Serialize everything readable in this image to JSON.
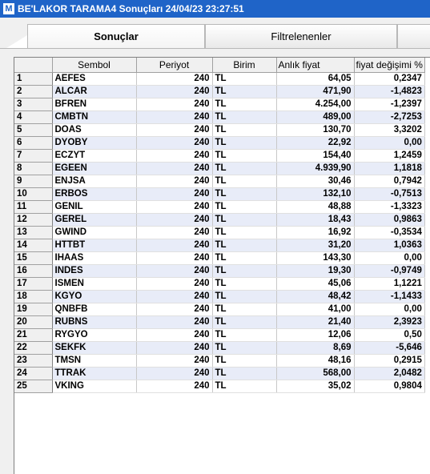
{
  "window": {
    "logo_letter": "M",
    "title": "BE'LAKOR TARAMA4 Sonuçları  24/04/23 23:27:51"
  },
  "tabs": [
    {
      "label": "Sonuçlar",
      "active": true
    },
    {
      "label": "Filtrelenenler",
      "active": false
    },
    {
      "label": "",
      "active": false
    }
  ],
  "table": {
    "headers": {
      "num": "",
      "sembol": "Sembol",
      "periyot": "Periyot",
      "birim": "Birim",
      "anlik": "Anlık fiyat",
      "degisim": "fiyat değişimi %"
    },
    "rows": [
      [
        "1",
        "AEFES",
        "240",
        "TL",
        "64,05",
        "0,2347"
      ],
      [
        "2",
        "ALCAR",
        "240",
        "TL",
        "471,90",
        "-1,4823"
      ],
      [
        "3",
        "BFREN",
        "240",
        "TL",
        "4.254,00",
        "-1,2397"
      ],
      [
        "4",
        "CMBTN",
        "240",
        "TL",
        "489,00",
        "-2,7253"
      ],
      [
        "5",
        "DOAS",
        "240",
        "TL",
        "130,70",
        "3,3202"
      ],
      [
        "6",
        "DYOBY",
        "240",
        "TL",
        "22,92",
        "0,00"
      ],
      [
        "7",
        "ECZYT",
        "240",
        "TL",
        "154,40",
        "1,2459"
      ],
      [
        "8",
        "EGEEN",
        "240",
        "TL",
        "4.939,90",
        "1,1818"
      ],
      [
        "9",
        "ENJSA",
        "240",
        "TL",
        "30,46",
        "0,7942"
      ],
      [
        "10",
        "ERBOS",
        "240",
        "TL",
        "132,10",
        "-0,7513"
      ],
      [
        "11",
        "GENIL",
        "240",
        "TL",
        "48,88",
        "-1,3323"
      ],
      [
        "12",
        "GEREL",
        "240",
        "TL",
        "18,43",
        "0,9863"
      ],
      [
        "13",
        "GWIND",
        "240",
        "TL",
        "16,92",
        "-0,3534"
      ],
      [
        "14",
        "HTTBT",
        "240",
        "TL",
        "31,20",
        "1,0363"
      ],
      [
        "15",
        "IHAAS",
        "240",
        "TL",
        "143,30",
        "0,00"
      ],
      [
        "16",
        "INDES",
        "240",
        "TL",
        "19,30",
        "-0,9749"
      ],
      [
        "17",
        "ISMEN",
        "240",
        "TL",
        "45,06",
        "1,1221"
      ],
      [
        "18",
        "KGYO",
        "240",
        "TL",
        "48,42",
        "-1,1433"
      ],
      [
        "19",
        "QNBFB",
        "240",
        "TL",
        "41,00",
        "0,00"
      ],
      [
        "20",
        "RUBNS",
        "240",
        "TL",
        "21,40",
        "2,3923"
      ],
      [
        "21",
        "RYGYO",
        "240",
        "TL",
        "12,06",
        "0,50"
      ],
      [
        "22",
        "SEKFK",
        "240",
        "TL",
        "8,69",
        "-5,646"
      ],
      [
        "23",
        "TMSN",
        "240",
        "TL",
        "48,16",
        "0,2915"
      ],
      [
        "24",
        "TTRAK",
        "240",
        "TL",
        "568,00",
        "2,0482"
      ],
      [
        "25",
        "VKING",
        "240",
        "TL",
        "35,02",
        "0,9804"
      ]
    ]
  }
}
